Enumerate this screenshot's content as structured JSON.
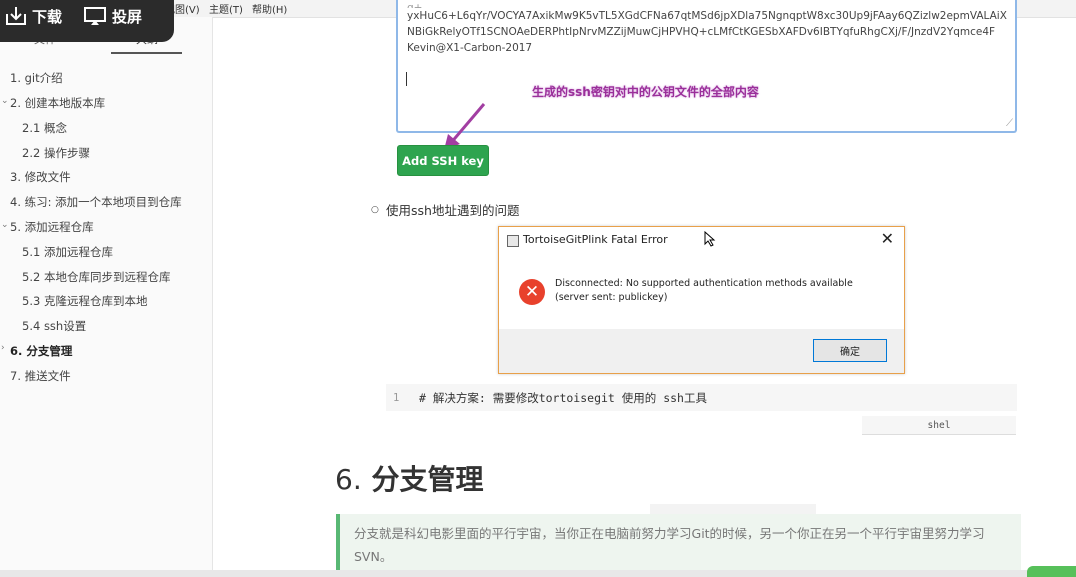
{
  "menubar": {
    "items": [
      "视图(V)",
      "主题(T)",
      "帮助(H)"
    ]
  },
  "overlay": {
    "download_label": "下载",
    "cast_label": "投屏"
  },
  "sidebar": {
    "tabs": [
      "文件",
      "大纲"
    ],
    "items": [
      {
        "label": "1. git介绍",
        "expanded": null
      },
      {
        "label": "2. 创建本地版本库",
        "expanded": true
      },
      {
        "label": "2.1 概念",
        "expanded": null
      },
      {
        "label": "2.2 操作步骤",
        "expanded": null
      },
      {
        "label": "3. 修改文件",
        "expanded": null
      },
      {
        "label": "4. 练习: 添加一个本地项目到仓库",
        "expanded": null
      },
      {
        "label": "5. 添加远程仓库",
        "expanded": true
      },
      {
        "label": "5.1 添加远程仓库",
        "expanded": null
      },
      {
        "label": "5.2 本地仓库同步到远程仓库",
        "expanded": null
      },
      {
        "label": "5.3 克隆远程仓库到本地",
        "expanded": null
      },
      {
        "label": "5.4 ssh设置",
        "expanded": null
      },
      {
        "label": "6. 分支管理",
        "expanded": false
      },
      {
        "label": "7. 推送文件",
        "expanded": null
      }
    ]
  },
  "key_area": {
    "lines": [
      "yxHuC6+L6qYr/VOCYA7AxikMw9K5vTL5XGdCFNa67qtMSd6jpXDla75NgnqptW8xc30Up9jFAay6QZizlw2epmVALAiX",
      "NBiGkRelyOTf1SCNOAeDERPhtIpNrvMZZijMuwCjHPVHQ+cLMfCtKGESbXAFDv6IBTYqfuRhgCXj/F/JnzdV2Yqmce4F",
      "Kevin@X1-Carbon-2017"
    ],
    "annotation": "生成的ssh密钥对中的公钥文件的全部内容"
  },
  "add_ssh_button": "Add SSH key",
  "bullet": "使用ssh地址遇到的问题",
  "dialog": {
    "title": "TortoiseGitPlink Fatal Error",
    "message": "Disconnected: No supported authentication methods available (server sent: publickey)",
    "ok_label": "确定",
    "close_glyph": "✕"
  },
  "code": {
    "line_number": "1",
    "text": "# 解决方案: 需要修改tortoisegit 使用的 ssh工具",
    "language": "shel"
  },
  "heading": {
    "number": "6.",
    "title": "分支管理"
  },
  "quote": "分支就是科幻电影里面的平行宇宙，当你正在电脑前努力学习Git的时候，另一个你正在另一个平行宇宙里努力学习SVN。"
}
